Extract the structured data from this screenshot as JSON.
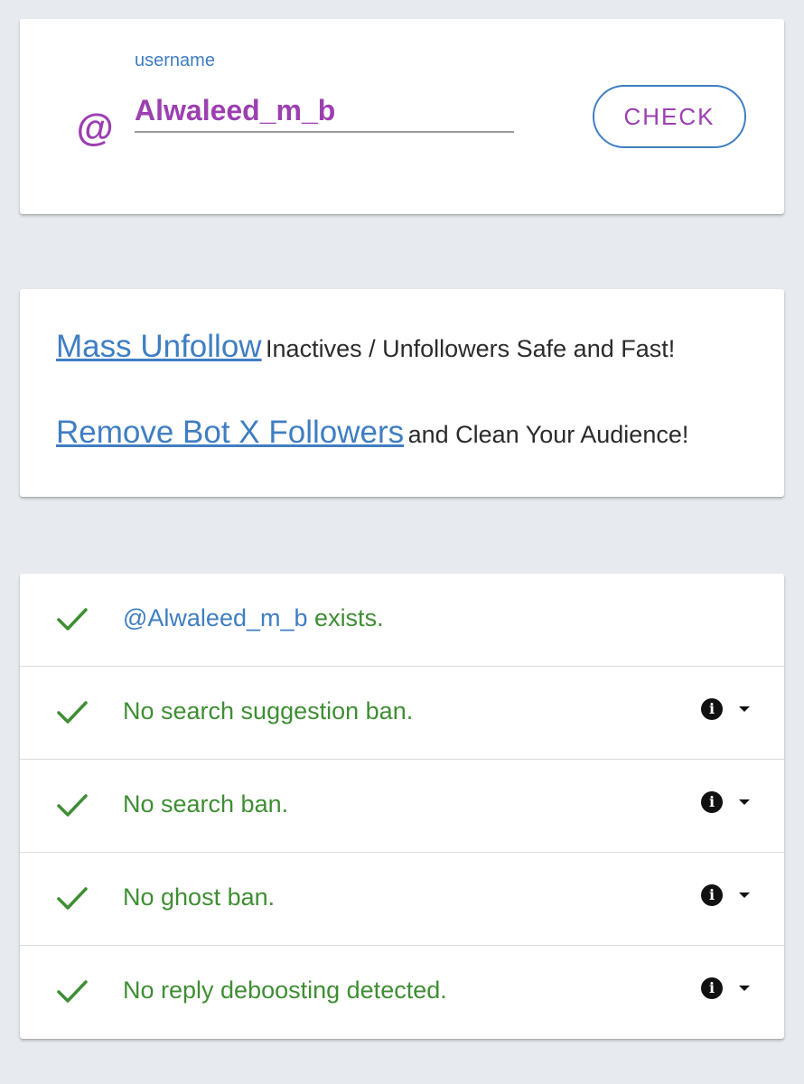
{
  "search": {
    "label": "username",
    "at_symbol": "@",
    "value": "Alwaleed_m_b",
    "button_label": "CHECK"
  },
  "promo": {
    "line1_link": "Mass Unfollow",
    "line1_text": "Inactives / Unfollowers Safe and Fast!",
    "line2_link": "Remove Bot X Followers",
    "line2_text": "and Clean Your Audience!"
  },
  "results": {
    "exists_handle": "@Alwaleed_m_b",
    "exists_text": "exists.",
    "search_suggestion": "No search suggestion ban.",
    "search_ban": "No search ban.",
    "ghost_ban": "No ghost ban.",
    "reply_deboosting": "No reply deboosting detected."
  },
  "icons": {
    "check": "checkmark-icon",
    "info": "info-icon",
    "caret": "caret-down-icon"
  },
  "colors": {
    "accent_purple": "#9c3fb0",
    "link_blue": "#3f7ec2",
    "success_green": "#3e8e33"
  }
}
